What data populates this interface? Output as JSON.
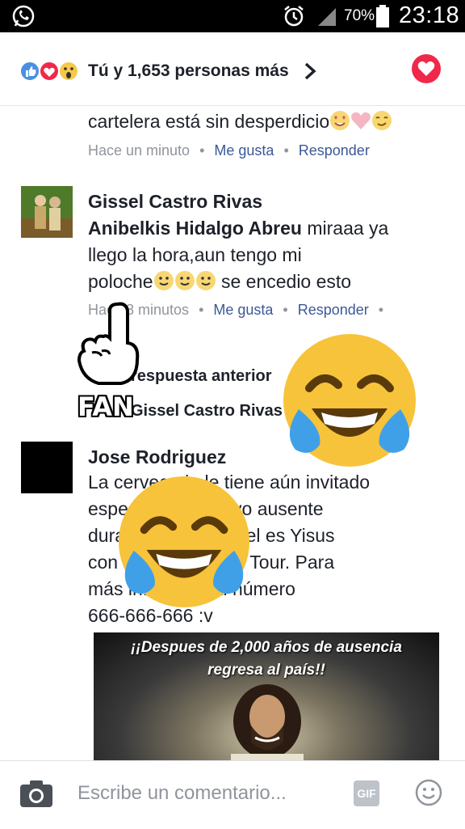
{
  "status_bar": {
    "battery_percent": "70%",
    "time": "23:18"
  },
  "reactions": {
    "summary": "Tú y 1,653 personas más"
  },
  "comments": [
    {
      "text": "cartelera está sin desperdicio",
      "time": "Hace un minuto",
      "like": "Me gusta",
      "reply": "Responder"
    },
    {
      "author": "Gissel Castro Rivas",
      "mention": "Anibelkis Hidalgo Abreu",
      "text_line1_rest": " miraaa ya",
      "text_line2": "llego la hora,aun tengo mi",
      "text_line3_start": "poloche",
      "text_line3_end": " se encedio esto",
      "time": "Hace 8 minutos",
      "like": "Me gusta",
      "reply": "Responder"
    },
    {
      "author": "Jose Rodriguez",
      "lines": [
        "La cerveceria le tiene aún invitado",
        "especial que estuvo ausente",
        "durante 2 mil años el es Yisus",
        "con su Gira Mundo Tour. Para",
        "más info llame al número",
        "666-666-666 :v"
      ],
      "image_text_line1": "¡¡Despues de 2,000 años de ausencia",
      "image_text_line2": "regresa al país!!"
    }
  ],
  "replies_section": {
    "previous_label": "respuesta anterior",
    "reply_author": "Gissel Castro Rivas"
  },
  "sticker": {
    "fan_text": "FAN"
  },
  "composer": {
    "placeholder": "Escribe un comentario...",
    "gif_label": "GIF"
  },
  "colors": {
    "link_blue": "#3b5998",
    "meta_gray": "#90949c",
    "heart_red": "#f0284a",
    "like_blue": "#4a90e2"
  }
}
